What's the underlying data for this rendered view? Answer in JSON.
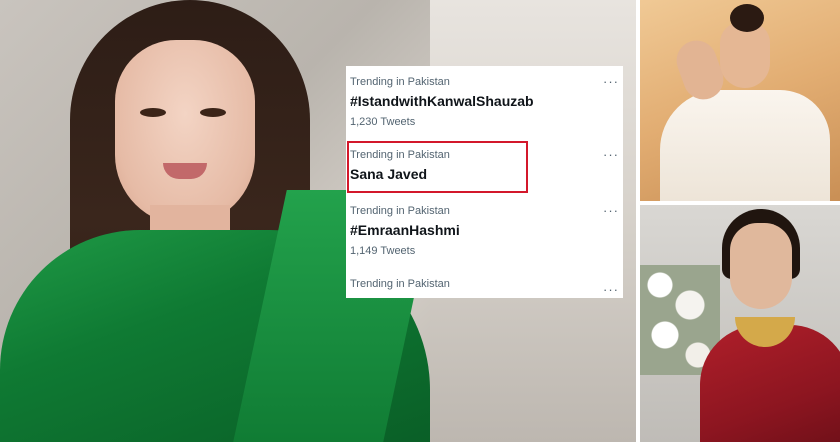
{
  "trends": [
    {
      "context": "Trending in Pakistan",
      "name": "#IstandwithKanwalShauzab",
      "count": "1,230 Tweets"
    },
    {
      "context": "Trending in Pakistan",
      "name": "Sana Javed",
      "count": ""
    },
    {
      "context": "Trending in Pakistan",
      "name": "#EmraanHashmi",
      "count": "1,149 Tweets"
    },
    {
      "context": "Trending in Pakistan",
      "name": "",
      "count": ""
    }
  ],
  "more_label": "···",
  "colors": {
    "highlight_border": "#d3182b",
    "trend_name": "#0f1419",
    "trend_meta": "#536471",
    "saree_green": "#0f7a33"
  },
  "icons": {
    "more": "ellipsis-icon"
  }
}
